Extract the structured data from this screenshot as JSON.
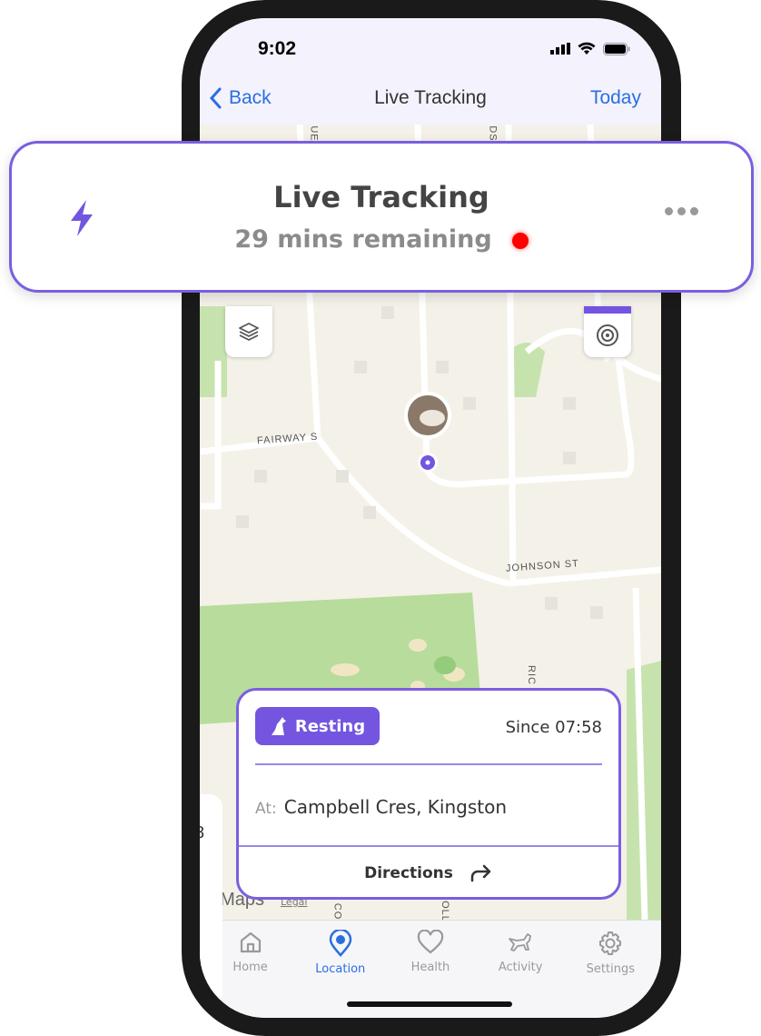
{
  "status_bar": {
    "time": "9:02"
  },
  "nav": {
    "back_label": "Back",
    "title": "Live Tracking",
    "right_label": "Today"
  },
  "banner": {
    "title": "Live Tracking",
    "subtitle": "29 mins remaining",
    "icon": "lightning-icon",
    "more_icon": "more-horizontal-icon",
    "live_dot_color": "#ff0000"
  },
  "map": {
    "streets": [
      "FAIRWAY S",
      "JOHNSON ST",
      "UE",
      "DS",
      "RIC",
      "CO",
      "OLL"
    ],
    "attribution": "Maps",
    "legal": "Legal",
    "side_card_partial": "8"
  },
  "card": {
    "status": "Resting",
    "since": "Since 07:58",
    "at_label": "At:",
    "location": "Campbell Cres, Kingston",
    "directions": "Directions"
  },
  "tabs": [
    {
      "label": "Home",
      "icon": "home-icon"
    },
    {
      "label": "Location",
      "icon": "location-pin-icon",
      "active": true
    },
    {
      "label": "Health",
      "icon": "heart-icon"
    },
    {
      "label": "Activity",
      "icon": "running-dog-icon"
    },
    {
      "label": "Settings",
      "icon": "gear-icon"
    }
  ],
  "colors": {
    "accent": "#7355e0",
    "link": "#2a6fe0"
  }
}
